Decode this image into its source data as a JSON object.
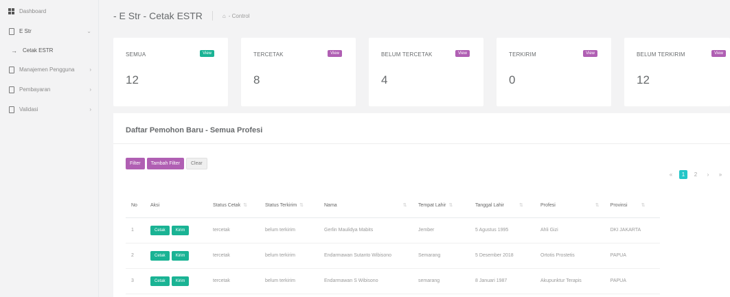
{
  "sidebar": {
    "items": [
      {
        "label": "Dashboard",
        "icon": "dashboard-grid-icon"
      },
      {
        "label": "E Str",
        "icon": "document-icon",
        "expanded": true
      },
      {
        "label": "Cetak ESTR",
        "icon": "arrow-right-icon",
        "sub": true
      },
      {
        "label": "Manajemen Pengguna",
        "icon": "document-icon"
      },
      {
        "label": "Pembayaran",
        "icon": "document-icon"
      },
      {
        "label": "Validasi",
        "icon": "document-icon"
      }
    ]
  },
  "header": {
    "title": "- E Str - Cetak ESTR",
    "breadcrumb": "- Control",
    "breadcrumb_icon": "home-icon"
  },
  "widgets": [
    {
      "title": "SEMUA",
      "label": "View",
      "value": "12",
      "label_color": "#1ab394"
    },
    {
      "title": "TERCETAK",
      "label": "View",
      "value": "8",
      "label_color": "#b05fb3"
    },
    {
      "title": "BELUM TERCETAK",
      "label": "View",
      "value": "4",
      "label_color": "#b05fb3"
    },
    {
      "title": "TERKIRIM",
      "label": "View",
      "value": "0",
      "label_color": "#b05fb3"
    },
    {
      "title": "BELUM TERKIRIM",
      "label": "View",
      "value": "12",
      "label_color": "#b05fb3"
    }
  ],
  "panel": {
    "title": "Daftar Pemohon Baru - Semua Profesi",
    "buttons": {
      "filter": "Filter",
      "add_filter": "Tambah Filter",
      "clear": "Clear"
    },
    "pager": {
      "prev": "«",
      "pages": [
        "1",
        "2"
      ],
      "active": "1",
      "next": "›",
      "last": "»"
    }
  },
  "table": {
    "columns": [
      "No",
      "Aksi",
      "Status Cetak",
      "Status Terkirim",
      "Nama",
      "Tempat Lahir",
      "Tanggal Lahir",
      "Profesi",
      "Provinsi"
    ],
    "action_labels": {
      "print": "Cetak",
      "send": "Kirim"
    },
    "rows": [
      [
        "1",
        "",
        "tercetak",
        "belum terkirim",
        "Gerlin Maulidya Mabits",
        "Jember",
        "5 Agustus 1995",
        "Ahli Gizi",
        "DKI JAKARTA"
      ],
      [
        "2",
        "",
        "tercetak",
        "belum terkirim",
        "Endarmawan Sutanto Wibisono",
        "Semarang",
        "5 Desember 2018",
        "Ortotis Prostetis",
        "PAPUA"
      ],
      [
        "3",
        "",
        "tercetak",
        "belum terkirim",
        "Endarmawan S Wibisono",
        "semarang",
        "8 Januari 1987",
        "Akupunktur Terapis",
        "PAPUA"
      ]
    ]
  }
}
